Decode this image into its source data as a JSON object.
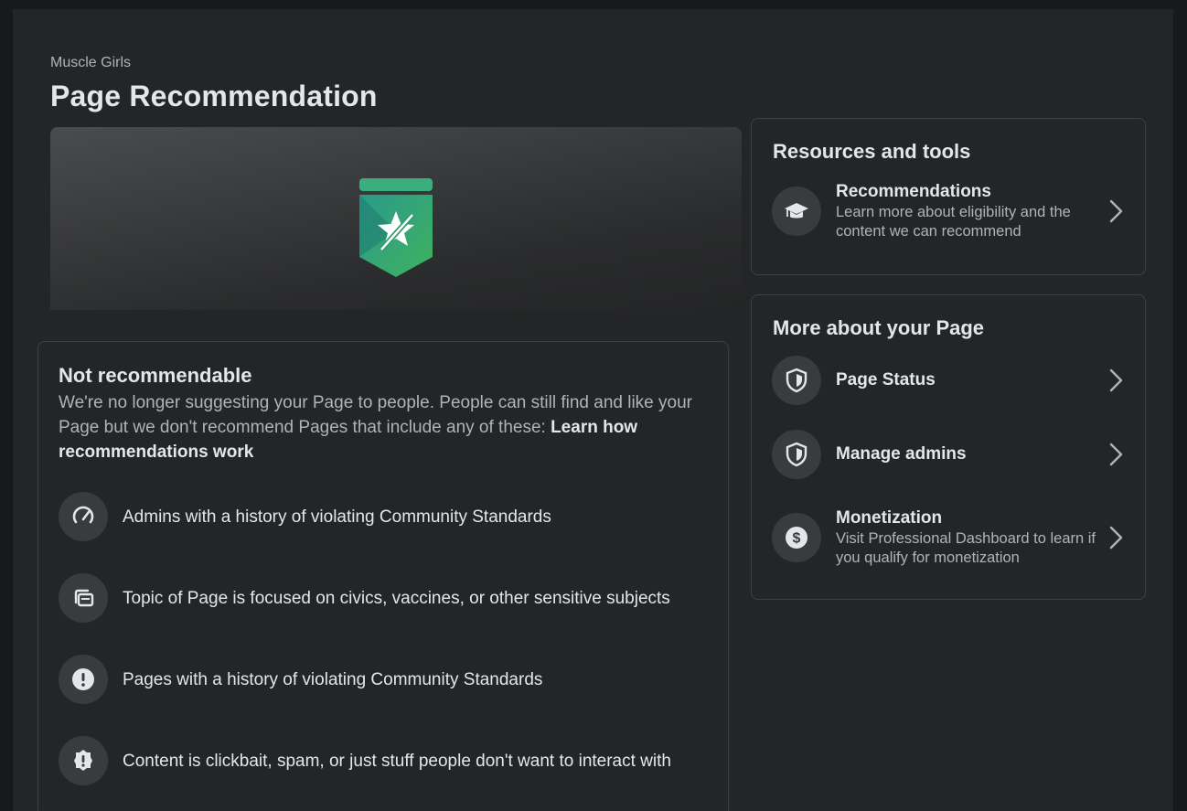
{
  "header": {
    "page_name": "Muscle Girls",
    "title": "Page Recommendation"
  },
  "status_card": {
    "title": "Not recommendable",
    "description": "We're no longer suggesting your Page to people. People can still find and like your Page but we don't recommend Pages that include any of these: ",
    "learn_link": "Learn how recommendations work",
    "reasons": [
      {
        "text": "Admins with a history of violating Community Standards",
        "icon": "speedometer-icon"
      },
      {
        "text": "Topic of Page is focused on civics, vaccines, or other sensitive subjects",
        "icon": "pages-stack-icon"
      },
      {
        "text": "Pages with a history of violating Community Standards",
        "icon": "exclamation-icon"
      },
      {
        "text": "Content is clickbait, spam, or just stuff people don't want to interact with",
        "icon": "ribbon-alert-icon"
      }
    ]
  },
  "resources": {
    "title": "Resources and tools",
    "items": [
      {
        "label": "Recommendations",
        "sub": "Learn more about eligibility and the content we can recommend",
        "icon": "graduation-cap-icon"
      }
    ]
  },
  "more": {
    "title": "More about your Page",
    "items": [
      {
        "label": "Page Status",
        "icon": "shield-icon"
      },
      {
        "label": "Manage admins",
        "icon": "shield-icon"
      },
      {
        "label": "Monetization",
        "sub": "Visit Professional Dashboard to learn if you qualify for monetization",
        "icon": "dollar-coin-icon"
      }
    ]
  },
  "colors": {
    "background": "#18191a",
    "surface": "#242526",
    "icon_bg": "#3a3b3c",
    "badge_top": "#2e8b7a",
    "badge_bottom": "#3fae5a"
  }
}
